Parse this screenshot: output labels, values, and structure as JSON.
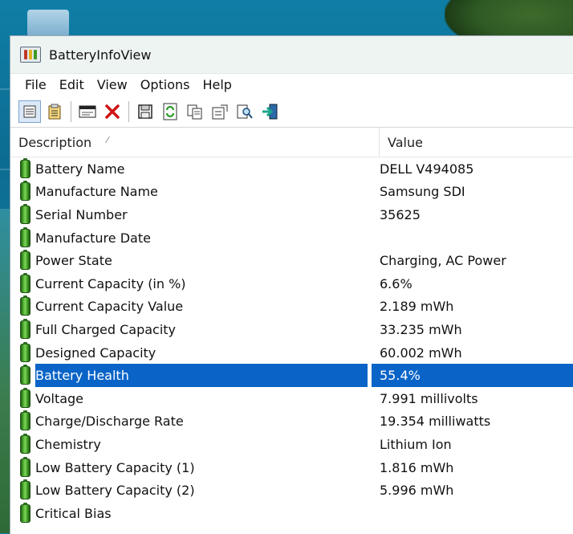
{
  "window": {
    "title": "BatteryInfoView"
  },
  "menu": [
    "File",
    "Edit",
    "View",
    "Options",
    "Help"
  ],
  "toolbar": {
    "icons": [
      "properties-icon",
      "clipboard-list-icon",
      "html-report-icon",
      "delete-icon",
      "save-icon",
      "refresh-icon",
      "copy-icon",
      "advanced-options-icon",
      "find-icon",
      "exit-icon"
    ]
  },
  "columns": {
    "description": "Description",
    "value": "Value"
  },
  "rows": [
    {
      "label": "Battery Name",
      "value": "DELL V494085"
    },
    {
      "label": "Manufacture Name",
      "value": "Samsung SDI"
    },
    {
      "label": "Serial Number",
      "value": "35625"
    },
    {
      "label": "Manufacture Date",
      "value": ""
    },
    {
      "label": "Power State",
      "value": "Charging, AC Power"
    },
    {
      "label": "Current Capacity (in %)",
      "value": "6.6%"
    },
    {
      "label": "Current Capacity Value",
      "value": "2.189 mWh"
    },
    {
      "label": "Full Charged Capacity",
      "value": "33.235 mWh"
    },
    {
      "label": "Designed Capacity",
      "value": "60.002 mWh"
    },
    {
      "label": "Battery Health",
      "value": "55.4%",
      "selected": true
    },
    {
      "label": "Voltage",
      "value": "7.991 millivolts"
    },
    {
      "label": "Charge/Discharge Rate",
      "value": "19.354 milliwatts"
    },
    {
      "label": "Chemistry",
      "value": "Lithium Ion"
    },
    {
      "label": "Low Battery Capacity (1)",
      "value": "1.816 mWh"
    },
    {
      "label": "Low Battery Capacity (2)",
      "value": "5.996 mWh"
    },
    {
      "label": "Critical Bias",
      "value": ""
    }
  ],
  "colors": {
    "selection": "#0a64c8",
    "battery": "#52b232"
  }
}
